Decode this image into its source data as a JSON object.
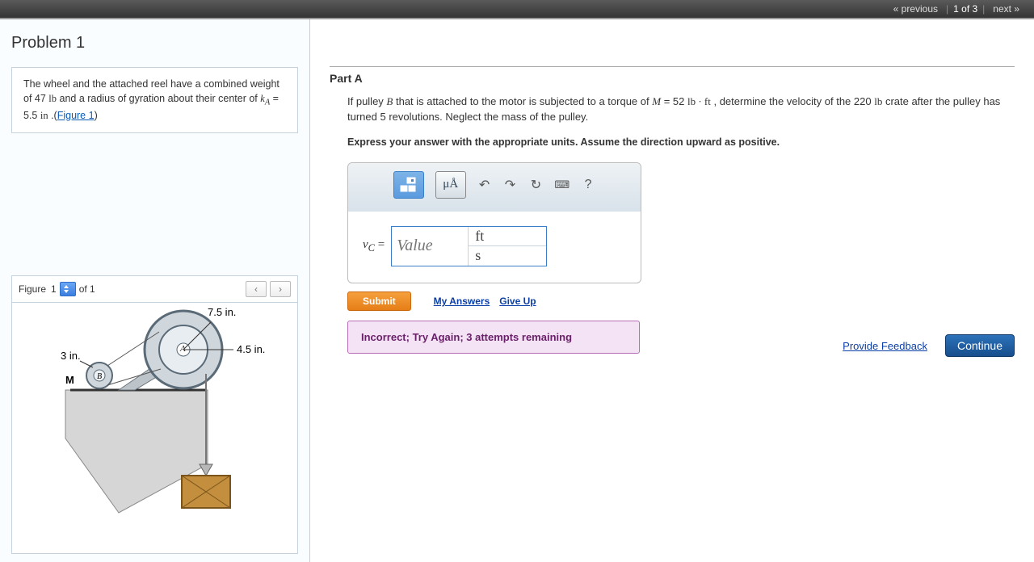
{
  "nav": {
    "prev": "« previous",
    "pos": "1 of 3",
    "next": "next »"
  },
  "problem_title": "Problem 1",
  "problem_text_1": "The wheel and the attached reel have a combined weight of 47 ",
  "problem_unit_lb": "lb",
  "problem_text_2": " and a radius of gyration about their center of ",
  "problem_kA": "k",
  "problem_kA_sub": "A",
  "problem_text_3": " = 5.5 ",
  "problem_unit_in": "in",
  "problem_text_4": " .(",
  "problem_figlink": "Figure 1",
  "problem_text_5": ")",
  "figbar": {
    "label": "Figure",
    "current": "1",
    "of": "of 1"
  },
  "figure": {
    "d75": "7.5 in.",
    "d45": "4.5 in.",
    "d3": "3 in.",
    "M": "M",
    "B": "B",
    "A": "A"
  },
  "part": {
    "label": "Part A"
  },
  "question_1": "If pulley ",
  "q_B": "B",
  "question_2": " that is attached to the motor is subjected to a torque of ",
  "q_M": "M",
  "question_3": " = 52 ",
  "q_lbft": "lb · ft",
  "question_4": " , determine the velocity of the 220 ",
  "q_lb": "lb",
  "question_5": " crate after the pulley has turned 5 revolutions. Neglect the mass of the pulley.",
  "instruction": "Express your answer with the appropriate units. Assume the direction upward as positive.",
  "toolbar": {
    "mu": "μÅ",
    "undo": "↶",
    "redo": "↷",
    "reset": "↻",
    "keybd": "⌨",
    "help": "?"
  },
  "input": {
    "var": "v",
    "sub": "C",
    "eq": " = ",
    "placeholder": "Value",
    "unit_top": "ft",
    "unit_bot": "s"
  },
  "actions": {
    "submit": "Submit",
    "myanswers": "My Answers",
    "giveup": "Give Up"
  },
  "feedback_msg": "Incorrect; Try Again; 3 attempts remaining",
  "footer": {
    "feedback": "Provide Feedback",
    "continue": "Continue"
  }
}
